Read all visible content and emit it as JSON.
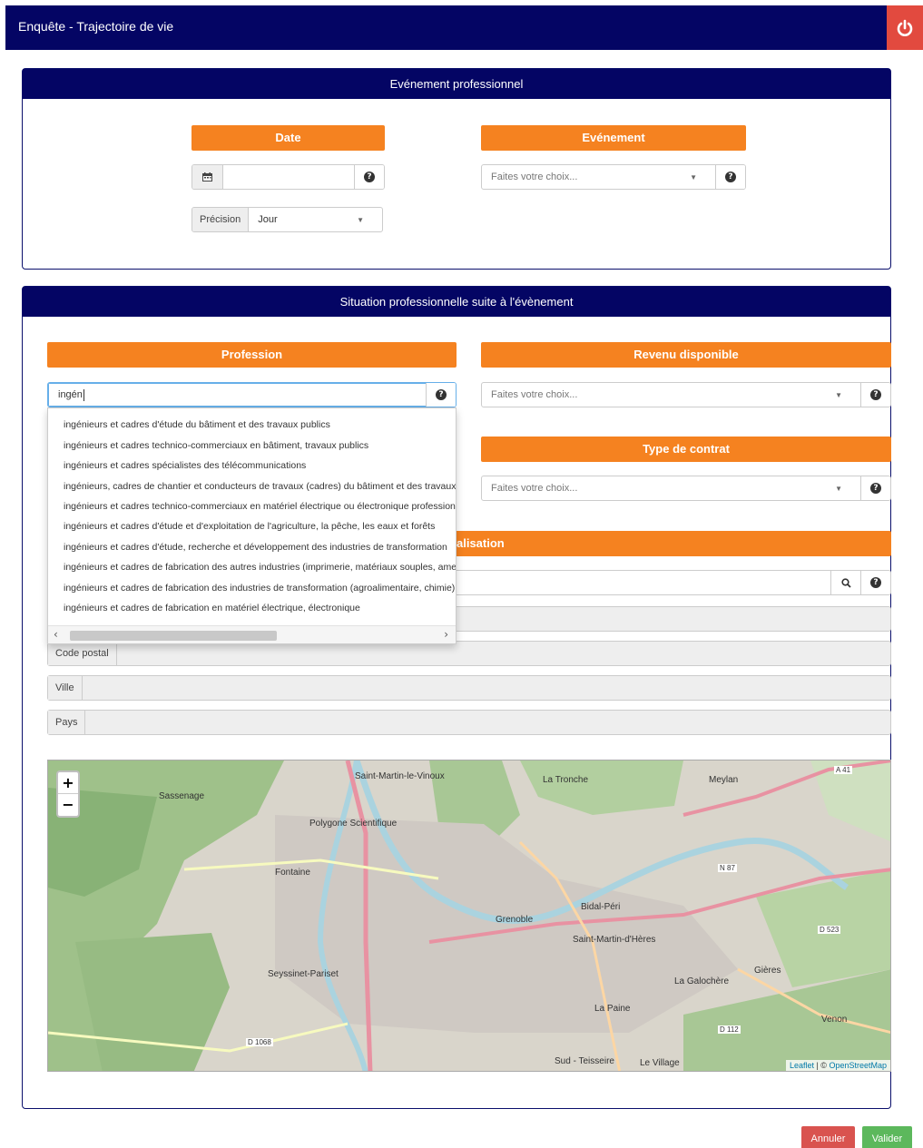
{
  "app": {
    "title": "Enquête - Trajectoire de vie"
  },
  "panel1": {
    "title": "Evénement professionnel",
    "date_label": "Date",
    "event_label": "Evénement",
    "event_placeholder": "Faites votre choix...",
    "precision_label": "Précision",
    "precision_value": "Jour"
  },
  "panel2": {
    "title": "Situation professionnelle suite à l'évènement",
    "profession_label": "Profession",
    "profession_value": "ingén",
    "revenu_label": "Revenu disponible",
    "revenu_placeholder": "Faites votre choix...",
    "contrat_label": "Type de contrat",
    "contrat_placeholder": "Faites votre choix...",
    "localisation_label_partial": "alisation",
    "code_postal_label": "Code postal",
    "ville_label": "Ville",
    "pays_label": "Pays"
  },
  "suggestions": [
    "ingénieurs et cadres d'étude du bâtiment et des travaux publics",
    "ingénieurs et cadres technico-commerciaux en bâtiment, travaux publics",
    "ingénieurs et cadres spécialistes des télécommunications",
    "ingénieurs, cadres de chantier et conducteurs de travaux (cadres) du bâtiment et des travaux publics",
    "ingénieurs et cadres technico-commerciaux en matériel électrique ou électronique professionnel",
    "ingénieurs et cadres d'étude et d'exploitation de l'agriculture, la pêche, les eaux et forêts",
    "ingénieurs et cadres d'étude, recherche et développement des industries de transformation",
    "ingénieurs et cadres de fabrication des autres industries (imprimerie, matériaux souples, ameublement et bois)",
    "ingénieurs et cadres de fabrication des industries de transformation (agroalimentaire, chimie)",
    "ingénieurs et cadres de fabrication en matériel électrique, électronique"
  ],
  "map": {
    "zoom_in": "+",
    "zoom_out": "−",
    "attribution_leaflet": "Leaflet",
    "attribution_sep": " | © ",
    "attribution_osm": "OpenStreetMap",
    "places": [
      "Saint-Martin-le-Vinoux",
      "La Tronche",
      "Meylan",
      "Sassenage",
      "Polygone Scientifique",
      "Fontaine",
      "Grenoble",
      "Bidal-Péri",
      "Saint-Martin-d'Hères",
      "Seyssinet-Pariset",
      "La Galochère",
      "Gières",
      "La Paine",
      "Sud - Teisseire",
      "Le Village",
      "Venon"
    ],
    "road_labels": [
      "A 41",
      "N 87",
      "D 523",
      "D 112",
      "D 1068"
    ]
  },
  "buttons": {
    "cancel": "Annuler",
    "validate": "Valider"
  },
  "colors": {
    "navy": "#040564",
    "orange": "#f58220",
    "danger": "#e24a3f",
    "success": "#5cb85c"
  }
}
